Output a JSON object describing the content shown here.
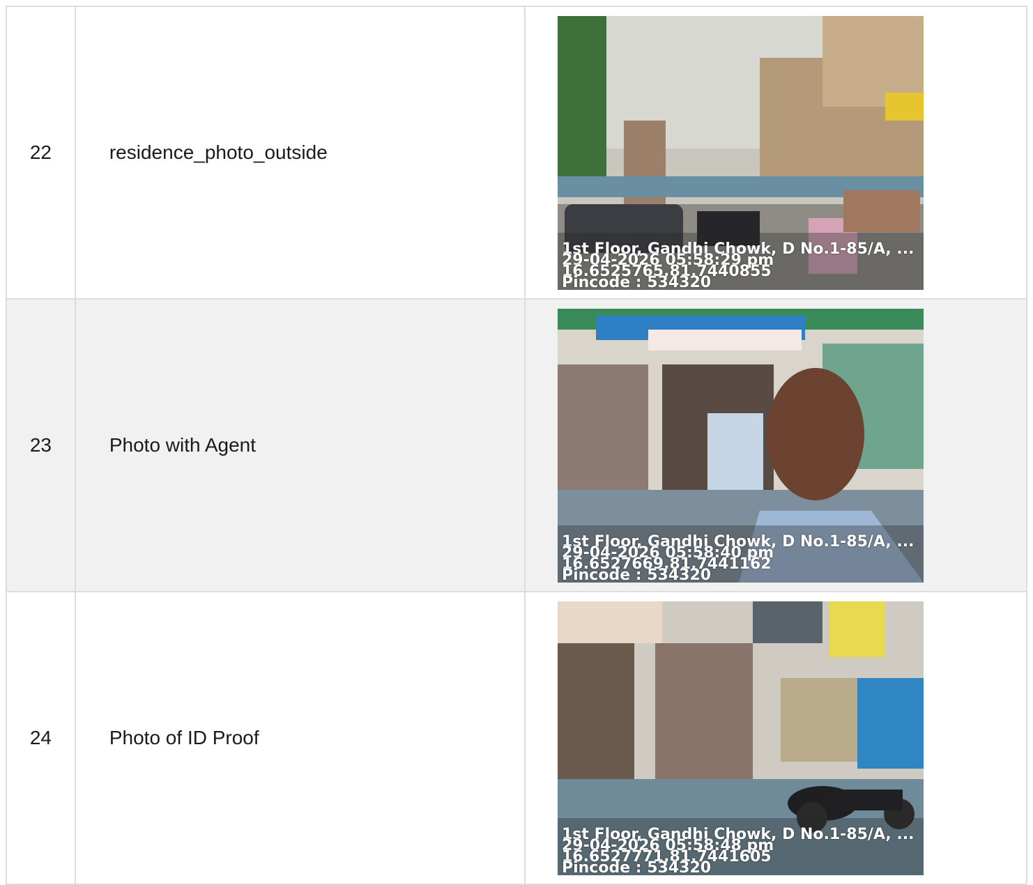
{
  "rows": [
    {
      "index": "22",
      "label": "residence_photo_outside",
      "stamp": {
        "address": "1st Floor, Gandhi Chowk, D No.1-85/A, ...",
        "datetime": "29-04-2026 05:58:29 pm",
        "coords": "16.6525765,81.7440855",
        "pincode": "Pincode : 534320"
      }
    },
    {
      "index": "23",
      "label": "Photo with Agent",
      "stamp": {
        "address": "1st Floor, Gandhi Chowk, D No.1-85/A, ...",
        "datetime": "29-04-2026 05:58:40 pm",
        "coords": "16.6527669,81.7441162",
        "pincode": "Pincode : 534320"
      }
    },
    {
      "index": "24",
      "label": "Photo of ID Proof",
      "stamp": {
        "address": "1st Floor, Gandhi Chowk, D No.1-85/A, ...",
        "datetime": "29-04-2026 05:58:48 pm",
        "coords": "16.6527771,81.7441605",
        "pincode": "Pincode : 534320"
      }
    }
  ]
}
